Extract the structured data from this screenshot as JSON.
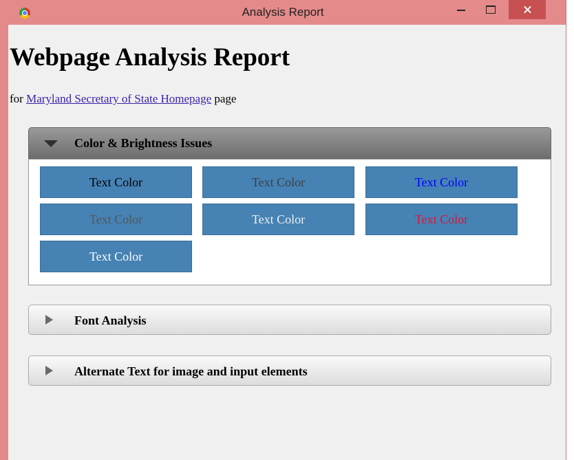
{
  "window": {
    "title": "Analysis Report"
  },
  "report": {
    "title": "Webpage Analysis Report",
    "subtitle_prefix": "for ",
    "page_link": "Maryland Secretary of State Homepage",
    "subtitle_suffix": " page"
  },
  "sections": [
    {
      "label": "Color & Brightness Issues",
      "expanded": true
    },
    {
      "label": "Font Analysis",
      "expanded": false
    },
    {
      "label": "Alternate Text for image and input elements",
      "expanded": false
    }
  ],
  "color_samples": [
    {
      "label": "Text Color",
      "text_color": "#000000",
      "background": "#4682b4"
    },
    {
      "label": "Text Color",
      "text_color": "#3f3f3f",
      "background": "#4682b4"
    },
    {
      "label": "Text Color",
      "text_color": "#0000ff",
      "background": "#4682b4"
    },
    {
      "label": "Text Color",
      "text_color": "#555555",
      "background": "#4682b4"
    },
    {
      "label": "Text Color",
      "text_color": "#f0f0f0",
      "background": "#4682b4"
    },
    {
      "label": "Text Color",
      "text_color": "#dc143c",
      "background": "#4682b4"
    },
    {
      "label": "Text Color",
      "text_color": "#ffffff",
      "background": "#4682b4"
    }
  ],
  "colors": {
    "window_frame": "#e48a8a",
    "close_button": "#c75050",
    "client_background": "#f0f0f0",
    "link": "#3b1fa8"
  },
  "icons": {
    "app": "chrome-icon",
    "minimize": "minimize-icon",
    "maximize": "maximize-icon",
    "close": "close-icon",
    "expanded": "triangle-down-icon",
    "collapsed": "triangle-right-icon"
  }
}
